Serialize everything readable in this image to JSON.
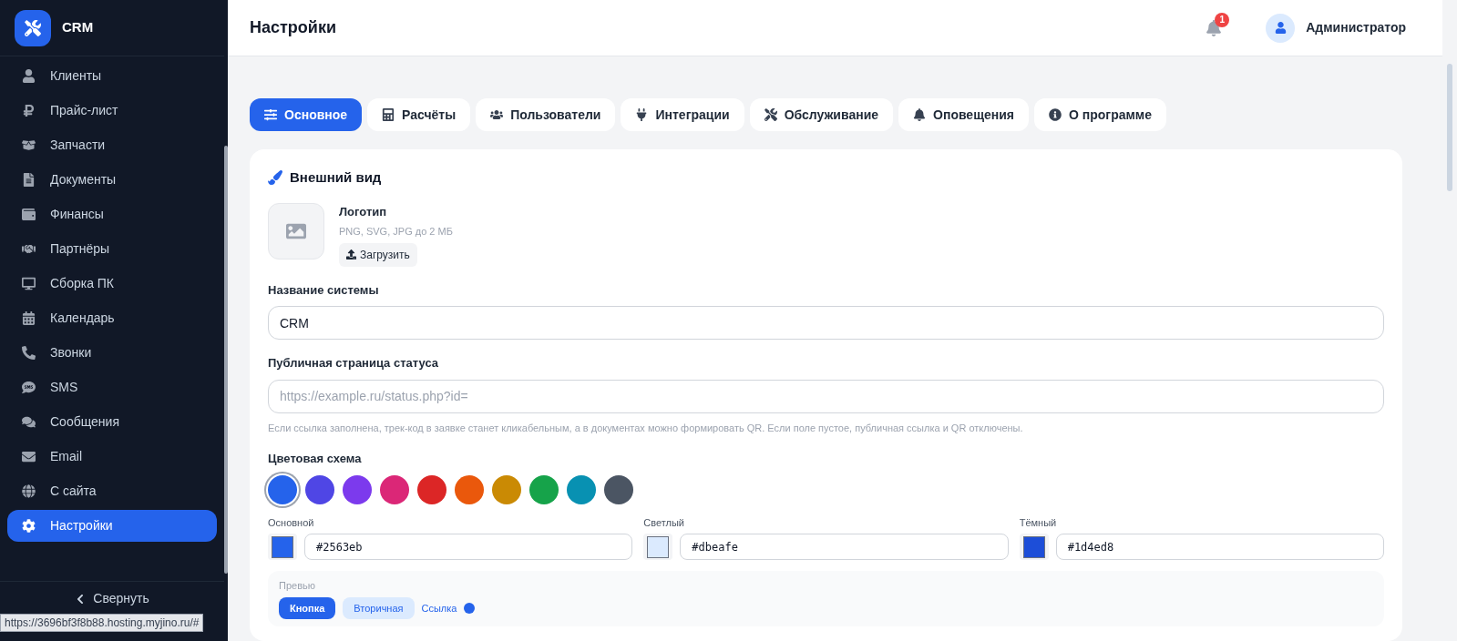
{
  "brand": {
    "name": "CRM"
  },
  "sidebar": {
    "items": [
      {
        "label": "Клиенты",
        "selected": false
      },
      {
        "label": "Прайс-лист",
        "selected": false
      },
      {
        "label": "Запчасти",
        "selected": false
      },
      {
        "label": "Документы",
        "selected": false
      },
      {
        "label": "Финансы",
        "selected": false
      },
      {
        "label": "Партнёры",
        "selected": false
      },
      {
        "label": "Сборка ПК",
        "selected": false
      },
      {
        "label": "Календарь",
        "selected": false
      },
      {
        "label": "Звонки",
        "selected": false
      },
      {
        "label": "SMS",
        "selected": false
      },
      {
        "label": "Сообщения",
        "selected": false
      },
      {
        "label": "Email",
        "selected": false
      },
      {
        "label": "С сайта",
        "selected": false
      },
      {
        "label": "Настройки",
        "selected": true
      }
    ],
    "collapse": "Свернуть"
  },
  "status_bar": {
    "url": "https://3696bf3f8b88.hosting.myjino.ru/#"
  },
  "header": {
    "title": "Настройки",
    "notifications": "1",
    "user": "Администратор"
  },
  "tabs": [
    {
      "label": "Основное",
      "selected": true
    },
    {
      "label": "Расчёты",
      "selected": false
    },
    {
      "label": "Пользователи",
      "selected": false
    },
    {
      "label": "Интеграции",
      "selected": false
    },
    {
      "label": "Обслуживание",
      "selected": false
    },
    {
      "label": "Оповещения",
      "selected": false
    },
    {
      "label": "О программе",
      "selected": false
    }
  ],
  "appearance": {
    "title": "Внешний вид",
    "logo": {
      "label": "Логотип",
      "hint": "PNG, SVG, JPG до 2 МБ",
      "upload": "Загрузить"
    },
    "system_name": {
      "label": "Название системы",
      "value": "CRM"
    },
    "status_page": {
      "label": "Публичная страница статуса",
      "placeholder": "https://example.ru/status.php?id=",
      "help": "Если ссылка заполнена, трек-код в заявке станет кликабельным, а в документах можно формировать QR. Если поле пустое, публичная ссылка и QR отключены."
    },
    "color_scheme": {
      "label": "Цветовая схема",
      "swatches": [
        {
          "color": "#2563eb",
          "selected": true
        },
        {
          "color": "#4f46e5",
          "selected": false
        },
        {
          "color": "#7c3aed",
          "selected": false
        },
        {
          "color": "#db2777",
          "selected": false
        },
        {
          "color": "#dc2626",
          "selected": false
        },
        {
          "color": "#ea580c",
          "selected": false
        },
        {
          "color": "#ca8a04",
          "selected": false
        },
        {
          "color": "#16a34a",
          "selected": false
        },
        {
          "color": "#0891b2",
          "selected": false
        },
        {
          "color": "#4b5563",
          "selected": false
        }
      ],
      "fields": [
        {
          "label": "Основной",
          "color": "#2563eb",
          "value": "#2563eb"
        },
        {
          "label": "Светлый",
          "color": "#dbeafe",
          "value": "#dbeafe"
        },
        {
          "label": "Тёмный",
          "color": "#1d4ed8",
          "value": "#1d4ed8"
        }
      ]
    },
    "preview": {
      "label": "Превью",
      "primary": "Кнопка",
      "secondary": "Вторичная",
      "link": "Ссылка"
    }
  }
}
